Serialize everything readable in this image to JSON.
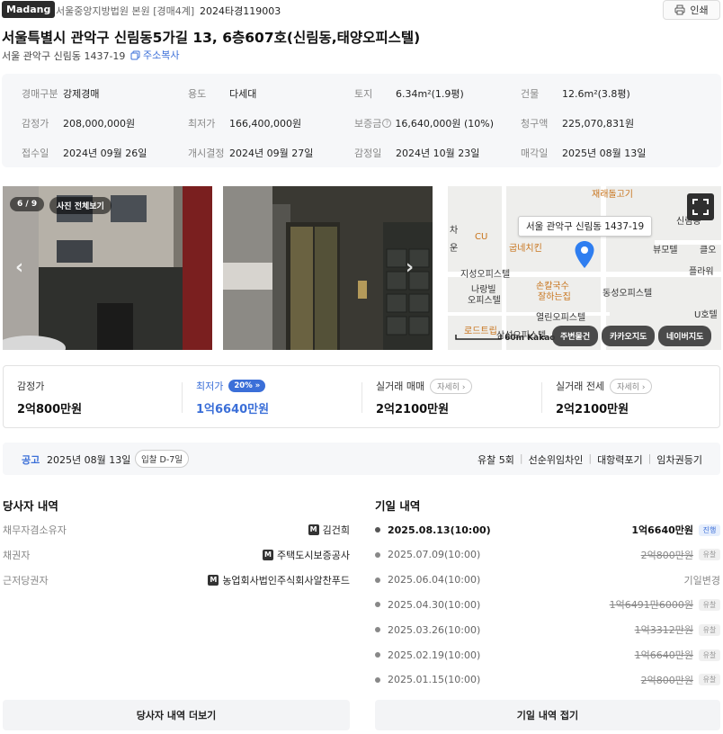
{
  "header": {
    "brand": "Madang",
    "court": "서울중앙지방법원 본원 [경매4계]",
    "case_no": "2024타경119003",
    "print_label": "인쇄",
    "title": "서울특별시 관악구 신림동5가길 13, 6층607호(신림동,태양오피스텔)",
    "jibun": "서울 관악구 신림동 1437-19",
    "copy_label": "주소복사"
  },
  "summary": [
    {
      "k": "경매구분",
      "v": "강제경매"
    },
    {
      "k": "용도",
      "v": "다세대"
    },
    {
      "k": "토지",
      "v": "6.34m²(1.9평)"
    },
    {
      "k": "건물",
      "v": "12.6m²(3.8평)"
    },
    {
      "k": "감정가",
      "v": "208,000,000원"
    },
    {
      "k": "최저가",
      "v": "166,400,000원"
    },
    {
      "k": "보증금",
      "v": "16,640,000원 (10%)",
      "help": "?"
    },
    {
      "k": "청구액",
      "v": "225,070,831원"
    },
    {
      "k": "접수일",
      "v": "2024년 09월 26일"
    },
    {
      "k": "개시결정",
      "v": "2024년 09월 27일"
    },
    {
      "k": "감정일",
      "v": "2024년 10월 23일"
    },
    {
      "k": "매각일",
      "v": "2025년 08월 13일"
    }
  ],
  "photos": {
    "counter": "6 / 9",
    "view_all": "사진 전체보기"
  },
  "map": {
    "address_popup": "서울 관악구 신림동 1437-19",
    "labels": [
      "CU",
      "굽네치킨",
      "지성오피스텔",
      "나랑빌",
      "오피스텔",
      "손칼국수",
      "잘하는집",
      "동성오피스텔",
      "열린오피스텔",
      "로드트립",
      "삼성오피스텔",
      "뷰모텔",
      "플라워",
      "신림동",
      "클오",
      "U호텔",
      "재래돌고기",
      "차",
      "운"
    ],
    "scale": "60m",
    "provider": "Kakao",
    "buttons": {
      "nearby": "주변물건",
      "kakao": "카카오지도",
      "naver": "네이버지도"
    }
  },
  "prices": {
    "appraisal_label": "감정가",
    "appraisal_value": "2억800만원",
    "min_label": "최저가",
    "min_pct": "20%",
    "min_value": "1억6640만원",
    "sale_label": "실거래 매매",
    "sale_value": "2억2100만원",
    "lease_label": "실거래 전세",
    "lease_value": "2억2100만원",
    "detail_label": "자세히"
  },
  "notice": {
    "label": "공고",
    "date": "2025년 08월 13일",
    "chip": "입찰 D-7일",
    "tags": [
      "유찰 5회",
      "선순위임차인",
      "대항력포기",
      "임차권등기"
    ]
  },
  "parties": {
    "title": "당사자 내역",
    "rows": [
      {
        "k": "채무자겸소유자",
        "v": "김건희"
      },
      {
        "k": "채권자",
        "v": "주택도시보증공사"
      },
      {
        "k": "근저당권자",
        "v": "농업회사법인주식회사알찬푸드"
      }
    ],
    "m_badge": "M",
    "more_label": "당사자 내역 더보기"
  },
  "schedule": {
    "title": "기일 내역",
    "rows": [
      {
        "date": "2025.08.13(10:00)",
        "price": "1억6640만원",
        "status": "진행"
      },
      {
        "date": "2025.07.09(10:00)",
        "price": "2억800만원",
        "status": "유찰"
      },
      {
        "date": "2025.06.04(10:00)",
        "price": "기일변경",
        "status": ""
      },
      {
        "date": "2025.04.30(10:00)",
        "price": "1억6491만6000원",
        "status": "유찰"
      },
      {
        "date": "2025.03.26(10:00)",
        "price": "1억3312만원",
        "status": "유찰"
      },
      {
        "date": "2025.02.19(10:00)",
        "price": "1억6640만원",
        "status": "유찰"
      },
      {
        "date": "2025.01.15(10:00)",
        "price": "2억800만원",
        "status": "유찰"
      }
    ],
    "fold_label": "기일 내역 접기"
  },
  "colors": {
    "accent": "#3b6fd8",
    "brand_bg": "#2b2b2b"
  }
}
